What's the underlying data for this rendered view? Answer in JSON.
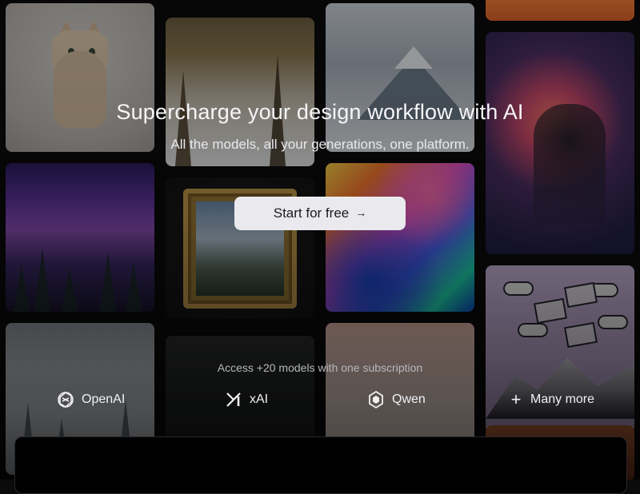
{
  "hero": {
    "title": "Supercharge your design workflow with AI",
    "subtitle": "All the models, all your generations, one platform.",
    "cta_label": "Start for free",
    "cta_arrow": "→"
  },
  "models": {
    "access_text": "Access +20 models with one subscription",
    "providers": [
      {
        "label": "OpenAI",
        "icon": "openai-icon"
      },
      {
        "label": "xAI",
        "icon": "xai-icon"
      },
      {
        "label": "Qwen",
        "icon": "qwen-icon"
      },
      {
        "label": "Many more",
        "icon": "plus-icon"
      }
    ]
  },
  "colors": {
    "background": "#0b0b0c",
    "cta_bg": "#e9e9ee",
    "text": "#f5f5f7",
    "muted": "#b7b7bd"
  }
}
